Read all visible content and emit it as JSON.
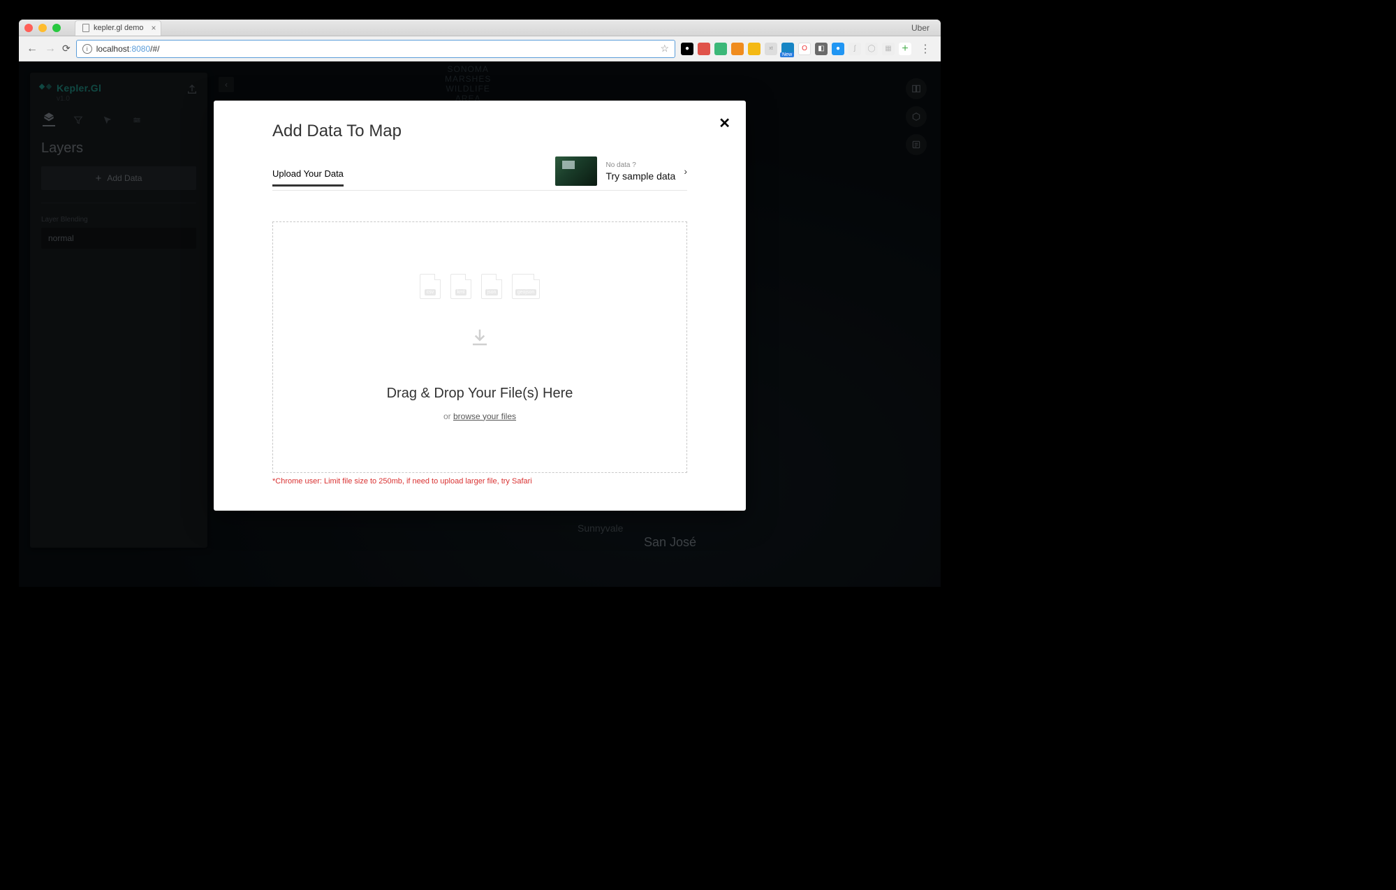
{
  "browser": {
    "tab_title": "kepler.gl demo",
    "brand_label": "Uber",
    "url_host": "localhost",
    "url_port": ":8080",
    "url_path": "/#/",
    "extension_new_badge": "New"
  },
  "map": {
    "area_label": "SONOMA\nMARSHES\nWILDLIFE\nAREA",
    "city_sunnyvale": "Sunnyvale",
    "city_sanjose": "San José"
  },
  "sidebar": {
    "brand": "Kepler.Gl",
    "version": "v1.0",
    "section_title": "Layers",
    "add_data_label": "Add Data",
    "layer_blending_label": "Layer Blending",
    "blend_value": "normal"
  },
  "modal": {
    "title": "Add Data To Map",
    "tab_upload": "Upload Your Data",
    "sample_q": "No data ?",
    "sample_try": "Try sample data",
    "file_types": {
      "csv": "csv",
      "kml": "kml",
      "json": "json",
      "geojson": "geojson"
    },
    "drop_title": "Drag & Drop Your File(s) Here",
    "or_label": "or ",
    "browse_label": "browse your files",
    "warn": "*Chrome user: Limit file size to 250mb, if need to upload larger file, try Safari"
  }
}
